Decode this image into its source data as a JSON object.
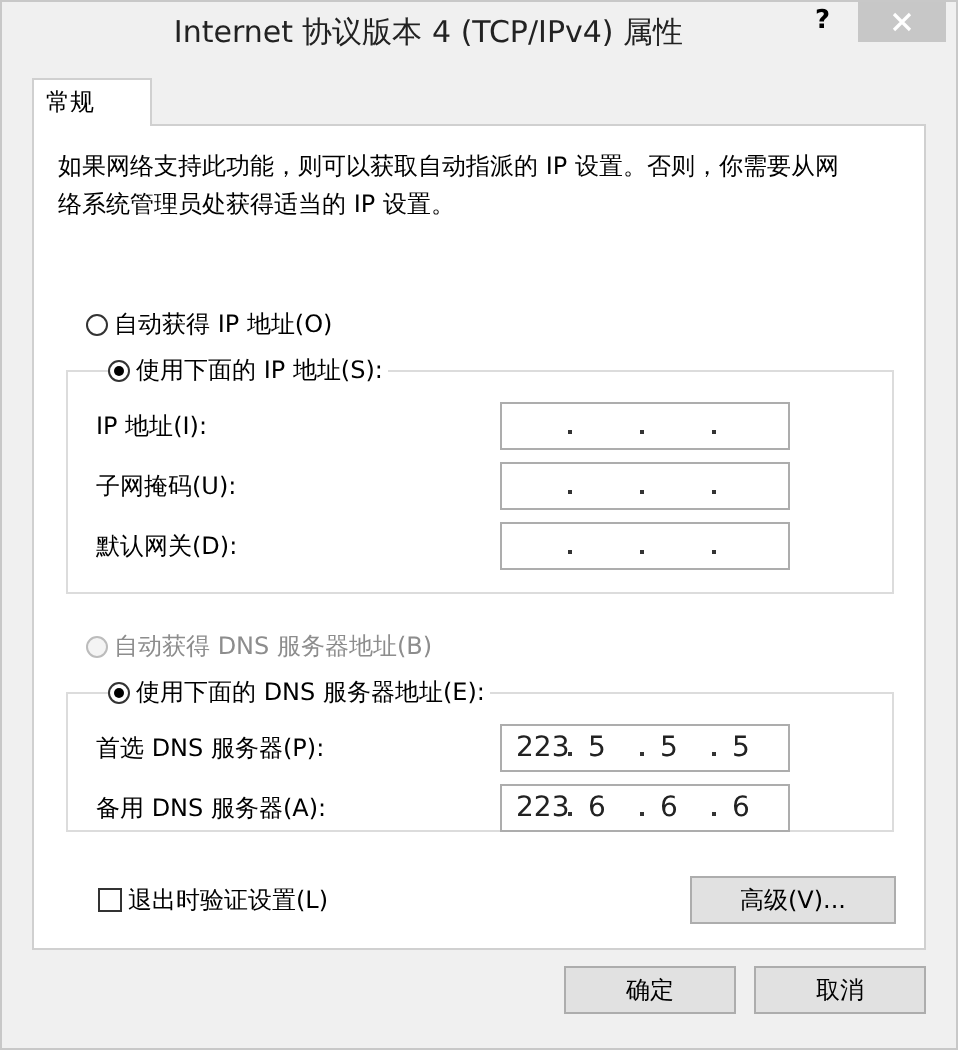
{
  "window": {
    "title": "Internet 协议版本 4 (TCP/IPv4) 属性",
    "help_button": "?"
  },
  "tabs": [
    {
      "label": "常规",
      "selected": true
    }
  ],
  "description": "如果网络支持此功能，则可以获取自动指派的 IP 设置。否则，你需要从网络系统管理员处获得适当的 IP 设置。",
  "ip_section": {
    "auto_option": {
      "label": "自动获得 IP 地址(O)",
      "selected": false,
      "disabled": false
    },
    "manual_option": {
      "label": "使用下面的 IP 地址(S):",
      "selected": true,
      "disabled": false
    },
    "fields": [
      {
        "label": "IP 地址(I):"
      },
      {
        "label": "子网掩码(U):"
      },
      {
        "label": "默认网关(D):"
      }
    ]
  },
  "dns_section": {
    "auto_option": {
      "label": "自动获得 DNS 服务器地址(B)",
      "selected": false,
      "disabled": true
    },
    "manual_option": {
      "label": "使用下面的 DNS 服务器地址(E):",
      "selected": true,
      "disabled": false
    },
    "fields": [
      {
        "label": "首选 DNS 服务器(P):",
        "octets": [
          "223",
          "5",
          "5",
          "5"
        ]
      },
      {
        "label": "备用 DNS 服务器(A):",
        "octets": [
          "223",
          "6",
          "6",
          "6"
        ]
      }
    ]
  },
  "validate_checkbox": {
    "label": "退出时验证设置(L)",
    "checked": false
  },
  "advanced_button": "高级(V)...",
  "buttons": [
    "确定",
    "取消"
  ]
}
